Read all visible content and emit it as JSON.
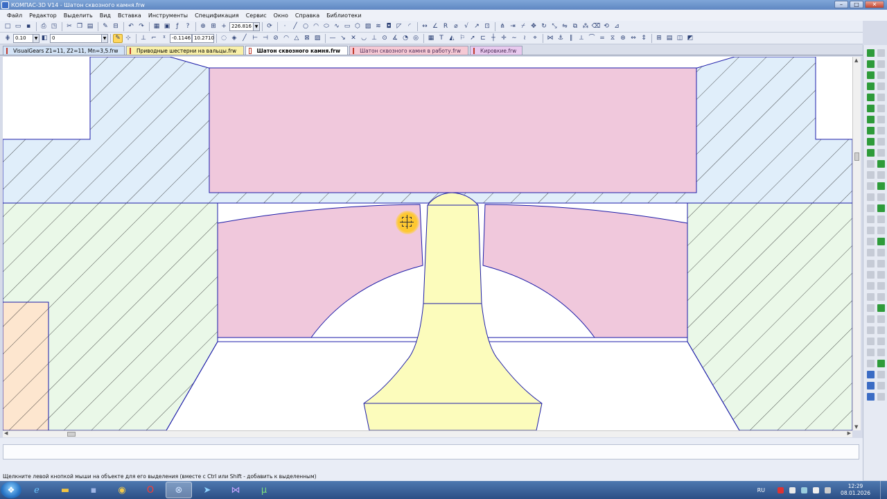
{
  "window": {
    "title": "КОМПАС-3D V14 - Шатон сквозного камня.frw",
    "controls": [
      "–",
      "□",
      "✕"
    ]
  },
  "menu": [
    "Файл",
    "Редактор",
    "Выделить",
    "Вид",
    "Вставка",
    "Инструменты",
    "Спецификация",
    "Сервис",
    "Окно",
    "Справка",
    "Библиотеки"
  ],
  "toolbar": {
    "scale_value": "226.816",
    "line_width": "0.10",
    "layer": "0",
    "coord_x": "-0.1146",
    "coord_y": "10.2710"
  },
  "tabs": [
    {
      "label": "VisualGears Z1=11, Z2=11, Mn=3,5.frw",
      "color": "blue"
    },
    {
      "label": "Приводные шестерни на вальцы.frw",
      "color": "yellow"
    },
    {
      "label": "Шатон сквозного камня.frw",
      "color": "active"
    },
    {
      "label": "Шатон сквозного камня в работу.frw",
      "color": "pink"
    },
    {
      "label": "Кировкие.frw",
      "color": "lilac"
    }
  ],
  "status": {
    "hint": "Щелкните левой кнопкой мыши на объекте для его выделения (вместе с Ctrl или Shift - добавить к выделенным)"
  },
  "taskbar": {
    "apps": [
      "windows-explorer",
      "internet-explorer",
      "file-explorer",
      "save-app",
      "chrome",
      "opera",
      "kompas",
      "telegram",
      "visual-studio",
      "utorrent"
    ],
    "language": "RU",
    "time": "12:29",
    "date": "08.01.2026"
  },
  "colors": {
    "outline": "#1a1aa8",
    "pink_fill": "#f0c8dc",
    "yellow_fill": "#fcfcbc",
    "blue_hatch": "#e0eefa",
    "green_hatch": "#eaf8e8",
    "orange_fill": "#fde6cf"
  }
}
